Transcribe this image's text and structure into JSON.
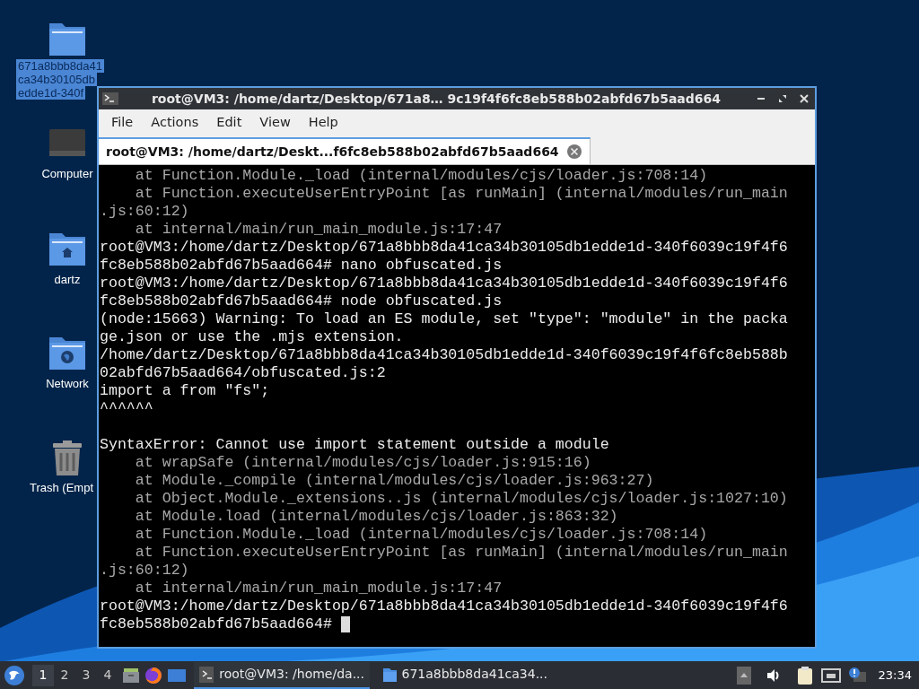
{
  "desktop_icons": [
    {
      "kind": "folder",
      "label_lines": [
        "671a8bbb8da41",
        "ca34b30105db",
        "edde1d-340f"
      ],
      "selected": true
    },
    {
      "kind": "computer",
      "label_lines": [
        "Computer"
      ],
      "selected": false
    },
    {
      "kind": "home",
      "label_lines": [
        "dartz"
      ],
      "selected": false
    },
    {
      "kind": "network",
      "label_lines": [
        "Network"
      ],
      "selected": false
    },
    {
      "kind": "trash",
      "label_lines": [
        "Trash (Empt"
      ],
      "selected": false
    }
  ],
  "window": {
    "title": "root@VM3: /home/dartz/Desktop/671a8… 9c19f4f6fc8eb588b02abfd67b5aad664",
    "menu": [
      "File",
      "Actions",
      "Edit",
      "View",
      "Help"
    ],
    "tabs": [
      {
        "label": "root@VM3: /home/dartz/Deskt...f6fc8eb588b02abfd67b5aad664",
        "selected": true
      }
    ],
    "terminal_lines": [
      {
        "kind": "dim",
        "text": "    at Function.Module._load (internal/modules/cjs/loader.js:708:14)"
      },
      {
        "kind": "dim",
        "text": "    at Function.executeUserEntryPoint [as runMain] (internal/modules/run_main"
      },
      {
        "kind": "dim",
        "text": ".js:60:12)"
      },
      {
        "kind": "dim",
        "text": "    at internal/main/run_main_module.js:17:47"
      },
      {
        "kind": "plain",
        "text": "root@VM3:/home/dartz/Desktop/671a8bbb8da41ca34b30105db1edde1d-340f6039c19f4f6"
      },
      {
        "kind": "plain",
        "text": "fc8eb588b02abfd67b5aad664# nano obfuscated.js"
      },
      {
        "kind": "plain",
        "text": "root@VM3:/home/dartz/Desktop/671a8bbb8da41ca34b30105db1edde1d-340f6039c19f4f6"
      },
      {
        "kind": "plain",
        "text": "fc8eb588b02abfd67b5aad664# node obfuscated.js"
      },
      {
        "kind": "plain",
        "text": "(node:15663) Warning: To load an ES module, set \"type\": \"module\" in the packa"
      },
      {
        "kind": "plain",
        "text": "ge.json or use the .mjs extension."
      },
      {
        "kind": "plain",
        "text": "/home/dartz/Desktop/671a8bbb8da41ca34b30105db1edde1d-340f6039c19f4f6fc8eb588b"
      },
      {
        "kind": "plain",
        "text": "02abfd67b5aad664/obfuscated.js:2"
      },
      {
        "kind": "plain",
        "text": "import a from \"fs\";"
      },
      {
        "kind": "plain",
        "text": "^^^^^^"
      },
      {
        "kind": "blank"
      },
      {
        "kind": "plain",
        "text": "SyntaxError: Cannot use import statement outside a module"
      },
      {
        "kind": "dim",
        "text": "    at wrapSafe (internal/modules/cjs/loader.js:915:16)"
      },
      {
        "kind": "dim",
        "text": "    at Module._compile (internal/modules/cjs/loader.js:963:27)"
      },
      {
        "kind": "dim",
        "text": "    at Object.Module._extensions..js (internal/modules/cjs/loader.js:1027:10)"
      },
      {
        "kind": "dim",
        "text": "    at Module.load (internal/modules/cjs/loader.js:863:32)"
      },
      {
        "kind": "dim",
        "text": "    at Function.Module._load (internal/modules/cjs/loader.js:708:14)"
      },
      {
        "kind": "dim",
        "text": "    at Function.executeUserEntryPoint [as runMain] (internal/modules/run_main"
      },
      {
        "kind": "dim",
        "text": ".js:60:12)"
      },
      {
        "kind": "dim",
        "text": "    at internal/main/run_main_module.js:17:47"
      },
      {
        "kind": "plain",
        "text": "root@VM3:/home/dartz/Desktop/671a8bbb8da41ca34b30105db1edde1d-340f6039c19f4f6"
      },
      {
        "kind": "prompt",
        "text": "fc8eb588b02abfd67b5aad664#"
      }
    ]
  },
  "taskbar": {
    "workspaces": [
      {
        "label": "1",
        "selected": true
      },
      {
        "label": "2",
        "selected": false
      },
      {
        "label": "3",
        "selected": false
      },
      {
        "label": "4",
        "selected": false
      }
    ],
    "tasks": [
      {
        "kind": "terminal",
        "label": "root@VM3: /home/da...",
        "selected": true
      },
      {
        "kind": "folder",
        "label": "671a8bbb8da41ca34...",
        "selected": false
      }
    ],
    "clock": "23:34"
  }
}
